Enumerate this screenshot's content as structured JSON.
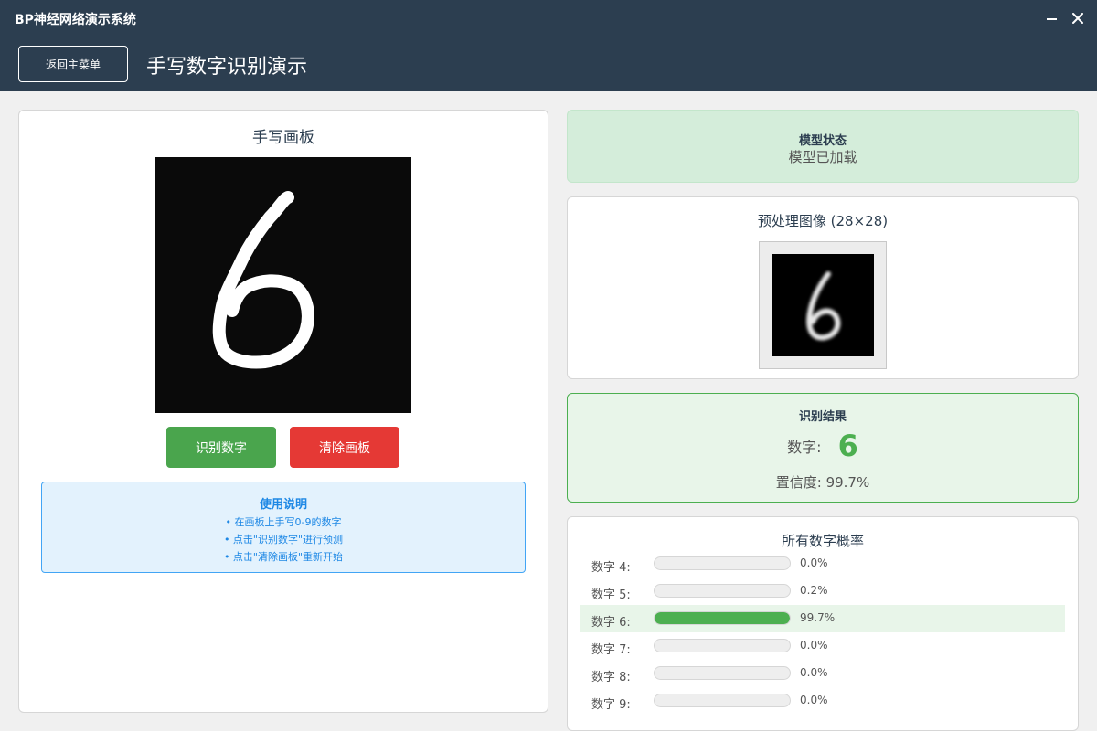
{
  "window": {
    "app_title": "BP神经网络演示系统"
  },
  "header": {
    "back_label": "返回主菜单",
    "page_title": "手写数字识别演示"
  },
  "canvas_panel": {
    "title": "手写画板",
    "recognize_label": "识别数字",
    "clear_label": "清除画板",
    "instructions": {
      "title": "使用说明",
      "lines": [
        "• 在画板上手写0-9的数字",
        "• 点击\"识别数字\"进行预测",
        "• 点击\"清除画板\"重新开始"
      ]
    }
  },
  "model_status": {
    "title": "模型状态",
    "value": "模型已加载"
  },
  "preprocessed": {
    "title": "预处理图像 (28×28)"
  },
  "result": {
    "title": "识别结果",
    "digit_label": "数字:",
    "digit_value": "6",
    "confidence_text": "置信度: 99.7%"
  },
  "probabilities": {
    "title": "所有数字概率",
    "rows": [
      {
        "label": "数字 4:",
        "value_text": "0.0%",
        "fraction": 0.0
      },
      {
        "label": "数字 5:",
        "value_text": "0.2%",
        "fraction": 0.002
      },
      {
        "label": "数字 6:",
        "value_text": "99.7%",
        "fraction": 0.997
      },
      {
        "label": "数字 7:",
        "value_text": "0.0%",
        "fraction": 0.0
      },
      {
        "label": "数字 8:",
        "value_text": "0.0%",
        "fraction": 0.0
      },
      {
        "label": "数字 9:",
        "value_text": "0.0%",
        "fraction": 0.0
      }
    ]
  },
  "colors": {
    "header_bg": "#2c3e50",
    "accent_green": "#4caf50",
    "danger_red": "#e53935",
    "info_blue": "#1e88e5"
  }
}
